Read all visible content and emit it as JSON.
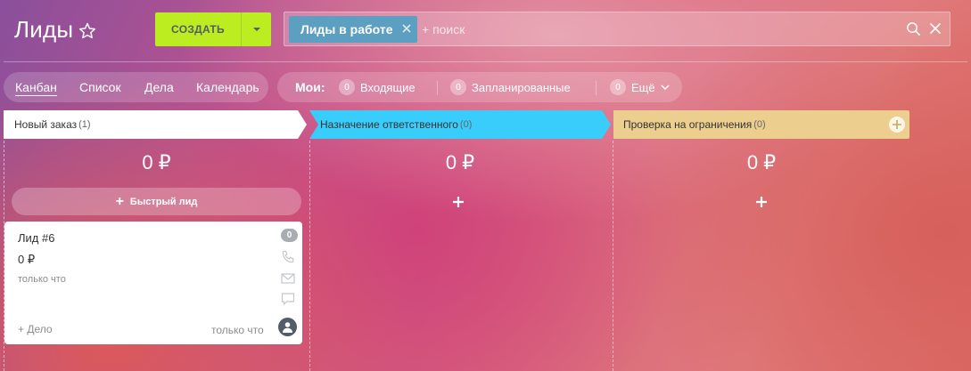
{
  "header": {
    "title": "Лиды",
    "create_label": "СОЗДАТЬ",
    "filter_chip": "Лиды в работе",
    "search_placeholder": "+ поиск"
  },
  "views": [
    {
      "label": "Канбан",
      "active": true
    },
    {
      "label": "Список",
      "active": false
    },
    {
      "label": "Дела",
      "active": false
    },
    {
      "label": "Календарь",
      "active": false
    }
  ],
  "counters": {
    "label": "Мои:",
    "items": [
      {
        "count": "0",
        "label": "Входящие"
      },
      {
        "count": "0",
        "label": "Запланированные"
      },
      {
        "count": "0",
        "label": "Ещё"
      }
    ]
  },
  "stages": [
    {
      "name": "Новый заказ",
      "count": "(1)",
      "sum": "0 ₽",
      "color": "#ffffff"
    },
    {
      "name": "Назначение ответственного",
      "count": "(0)",
      "sum": "0 ₽",
      "color": "#39cdfb"
    },
    {
      "name": "Проверка на ограничения",
      "count": "(0)",
      "sum": "0 ₽",
      "color": "#ecce8e"
    }
  ],
  "quick_lead_label": "Быстрый лид",
  "card": {
    "title": "Лид #6",
    "sum": "0 ₽",
    "time": "только что",
    "badge": "0",
    "add_activity": "+ Дело",
    "footer_time": "только что"
  },
  "colors": {
    "create_button": "#bbed21",
    "filter_chip": "#5c9fc1"
  }
}
